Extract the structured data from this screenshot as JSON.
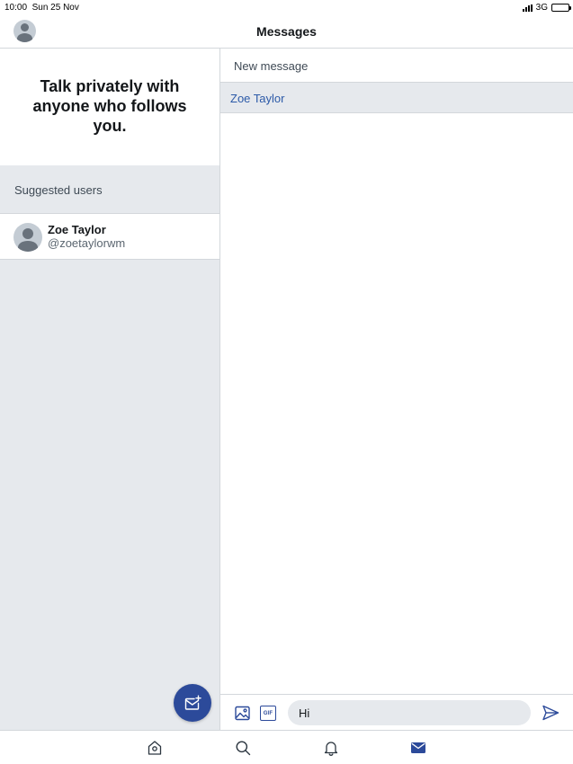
{
  "status_bar": {
    "time": "10:00",
    "date": "Sun 25 Nov",
    "network": "3G"
  },
  "header": {
    "title": "Messages",
    "avatar_icon": "user-avatar-icon"
  },
  "left_pane": {
    "promo_text": "Talk privately with anyone who follows you.",
    "suggested_label": "Suggested users",
    "suggested_users": [
      {
        "name": "Zoe Taylor",
        "handle": "@zoetaylorwm"
      }
    ],
    "compose_icon": "new-message-icon"
  },
  "right_pane": {
    "new_message_label": "New message",
    "recipient": "Zoe Taylor",
    "composer": {
      "image_icon": "image-icon",
      "gif_label": "GIF",
      "input_value": "Hi",
      "send_icon": "send-icon"
    }
  },
  "tab_bar": {
    "tabs": [
      {
        "icon": "home-icon",
        "active": false
      },
      {
        "icon": "search-icon",
        "active": false
      },
      {
        "icon": "bell-icon",
        "active": false
      },
      {
        "icon": "mail-icon",
        "active": true
      }
    ]
  },
  "colors": {
    "accent": "#2c4a9a",
    "link": "#2c5aa8",
    "pane_bg": "#e6e9ed",
    "divider": "#d3d7db"
  }
}
